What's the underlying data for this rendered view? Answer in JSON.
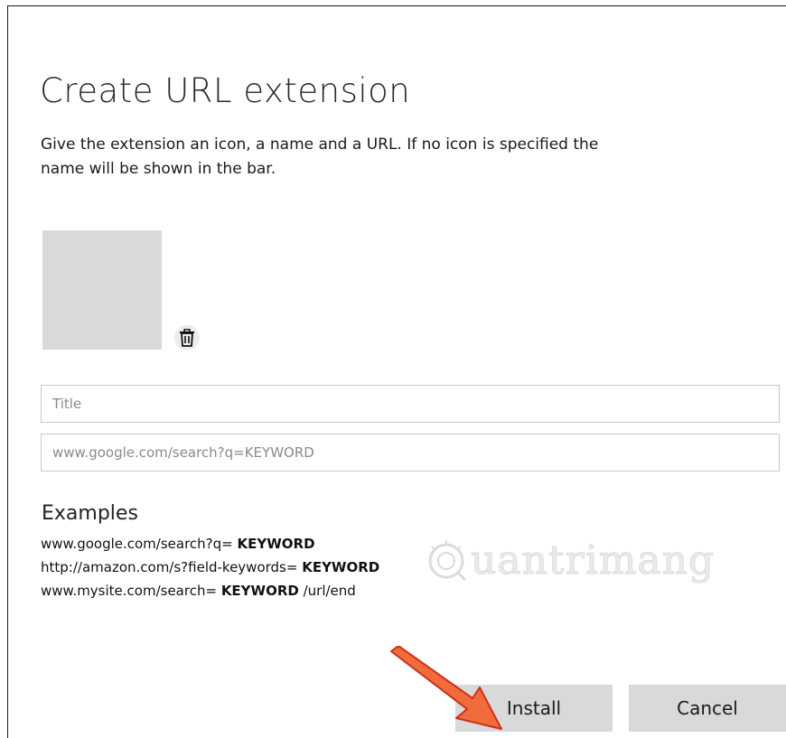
{
  "dialog": {
    "title": "Create URL extension",
    "description": "Give the extension an icon, a name and a URL. If no icon is specified the name will be shown in the bar."
  },
  "icon_area": {
    "delete_icon": "trash-icon"
  },
  "fields": {
    "title_placeholder": "Title",
    "url_placeholder": "www.google.com/search?q=KEYWORD"
  },
  "examples": {
    "heading": "Examples",
    "lines": [
      {
        "prefix": "www.google.com/search?q= ",
        "keyword": "KEYWORD",
        "suffix": ""
      },
      {
        "prefix": "http://amazon.com/s?field-keywords= ",
        "keyword": "KEYWORD",
        "suffix": ""
      },
      {
        "prefix": "www.mysite.com/search= ",
        "keyword": "KEYWORD",
        "suffix": " /url/end"
      }
    ]
  },
  "watermark": {
    "text": "uantrimang"
  },
  "buttons": {
    "install_label": "Install",
    "cancel_label": "Cancel"
  },
  "colors": {
    "button_bg": "#d9d9d9",
    "icon_placeholder": "#d9d9d9",
    "arrow": "#e8402a"
  }
}
